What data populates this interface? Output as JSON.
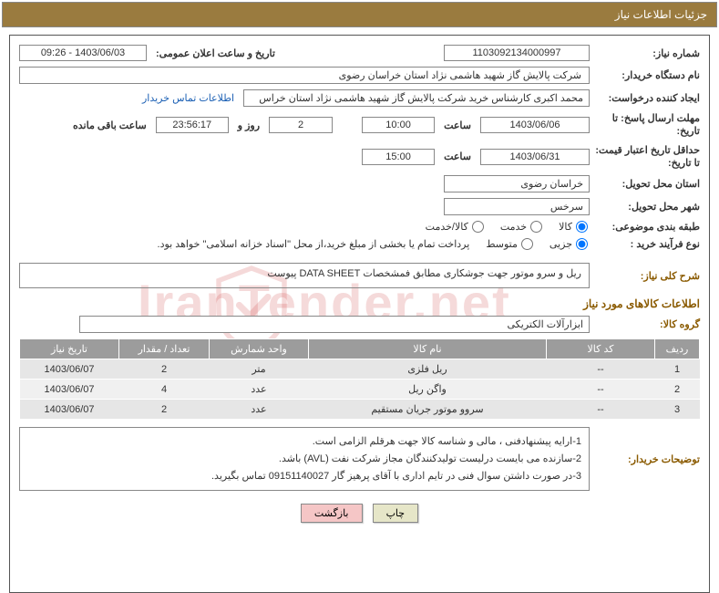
{
  "header": {
    "title": "جزئیات اطلاعات نیاز"
  },
  "need": {
    "number_label": "شماره نیاز:",
    "number": "1103092134000997",
    "announce_label": "تاریخ و ساعت اعلان عمومی:",
    "announce_value": "1403/06/03 - 09:26",
    "buyer_org_label": "نام دستگاه خریدار:",
    "buyer_org": "شرکت پالایش گاز شهید هاشمی نژاد   استان خراسان رضوی",
    "requester_label": "ایجاد کننده درخواست:",
    "requester": "محمد اکبری کارشناس خرید شرکت پالایش گاز شهید هاشمی نژاد   استان خراس",
    "contact_link": "اطلاعات تماس خریدار",
    "deadline_label": "مهلت ارسال پاسخ: تا تاریخ:",
    "deadline_date": "1403/06/06",
    "time_label": "ساعت",
    "deadline_time": "10:00",
    "days": "2",
    "days_label": "روز و",
    "remaining_time": "23:56:17",
    "remaining_label": "ساعت باقی مانده",
    "validity_label": "حداقل تاریخ اعتبار قیمت: تا تاریخ:",
    "validity_date": "1403/06/31",
    "validity_time": "15:00",
    "province_label": "استان محل تحویل:",
    "province": "خراسان رضوی",
    "city_label": "شهر محل تحویل:",
    "city": "سرخس",
    "category_label": "طبقه بندی موضوعی:",
    "cat_goods": "کالا",
    "cat_service": "خدمت",
    "cat_both": "کالا/خدمت",
    "process_label": "نوع فرآیند خرید :",
    "proc_small": "جزیی",
    "proc_medium": "متوسط",
    "process_note": "پرداخت تمام یا بخشی از مبلغ خرید،از محل \"اسناد خزانه اسلامی\" خواهد بود.",
    "desc_label": "شرح کلی نیاز:",
    "desc": "ریل و سرو موتور جهت جوشکاری مطابق فمشخصات DATA SHEET پیوست",
    "items_title": "اطلاعات کالاهای مورد نیاز",
    "group_label": "گروه کالا:",
    "group": "ابزارآلات الکتریکی"
  },
  "table": {
    "headers": [
      "ردیف",
      "کد کالا",
      "نام کالا",
      "واحد شمارش",
      "تعداد / مقدار",
      "تاریخ نیاز"
    ],
    "rows": [
      {
        "n": "1",
        "code": "--",
        "name": "ریل فلزی",
        "unit": "متر",
        "qty": "2",
        "date": "1403/06/07"
      },
      {
        "n": "2",
        "code": "--",
        "name": "واگن ریل",
        "unit": "عدد",
        "qty": "4",
        "date": "1403/06/07"
      },
      {
        "n": "3",
        "code": "--",
        "name": "سروو موتور جریان مستقیم",
        "unit": "عدد",
        "qty": "2",
        "date": "1403/06/07"
      }
    ]
  },
  "buyer_note": {
    "label": "توضیحات خریدار:",
    "line1": "1-ارایه پیشنهادفنی ، مالی و شناسه کالا جهت هرقلم الزامی است.",
    "line2": "2-سازنده می بایست درلیست تولیدکنندگان مجاز شرکت نفت (AVL)  باشد.",
    "line3": "3-در صورت داشتن سوال فنی در تایم اداری با آقای پرهیز گار 09151140027 تماس بگیرید."
  },
  "buttons": {
    "print": "چاپ",
    "back": "بازگشت"
  },
  "watermark": "IranTender.net"
}
